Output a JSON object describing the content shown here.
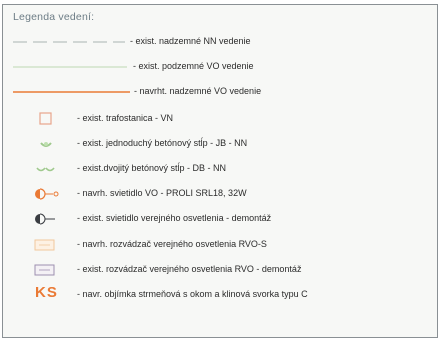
{
  "legend": {
    "title": "Legenda vedení:",
    "items": [
      {
        "symbol": "dashed-line-icon",
        "label": "- exist. nadzemné NN vedenie"
      },
      {
        "symbol": "thin-green-line-icon",
        "label": "- exist. podzemné VO vedenie"
      },
      {
        "symbol": "orange-line-icon",
        "label": "- navrht. nadzemné VO vedenie"
      },
      {
        "symbol": "square-icon",
        "label": "- exist. trafostanica - VN"
      },
      {
        "symbol": "single-pole-icon",
        "label": "- exist. jednoduchý betónový stĺp - JB - NN"
      },
      {
        "symbol": "double-pole-icon",
        "label": "- exist.dvojitý betónový stĺp - DB - NN"
      },
      {
        "symbol": "streetlight-new-icon",
        "label": "- navrh. svietidlo VO - PROLI SRL18, 32W"
      },
      {
        "symbol": "streetlight-demolish-icon",
        "label": "- exist. svietidlo verejného osvetlenia - demontáž"
      },
      {
        "symbol": "switchboard-new-icon",
        "label": "- navrh. rozvádzač verejného osvetlenia RVO-S"
      },
      {
        "symbol": "switchboard-demolish-icon",
        "label": "- exist. rozvádzač verejného osvetlenia RVO - demontáž"
      },
      {
        "symbol": "clamp-ks-icon",
        "symbol_text": "KS",
        "label": "- navr. objímka strmeňová s okom a klinová svorka typu C"
      }
    ]
  },
  "colors": {
    "orange": "#ea7a35",
    "green": "#9fc98d",
    "gray_dash": "#b9c2bf",
    "title": "#6d7d86"
  }
}
